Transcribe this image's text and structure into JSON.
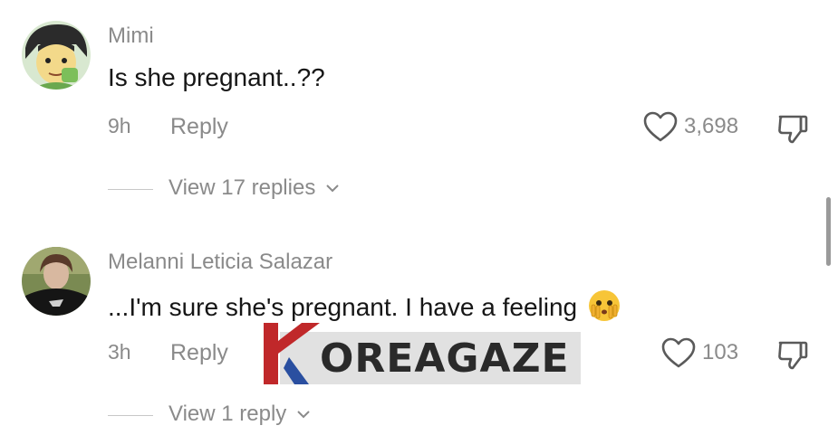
{
  "comments": [
    {
      "username": "Mimi",
      "text": "Is she pregnant..??",
      "time": "9h",
      "reply_label": "Reply",
      "likes": "3,698",
      "view_replies": "View 17 replies"
    },
    {
      "username": "Melanni Leticia Salazar",
      "text": "...I'm sure she's pregnant. I have a feeling",
      "emoji": "face-with-peeking-eye",
      "time": "3h",
      "reply_label": "Reply",
      "likes": "103",
      "view_replies": "View 1 reply"
    }
  ],
  "watermark": {
    "text": "OREAGAZE",
    "brand_red": "#c0282a",
    "brand_blue": "#2a4fa0"
  },
  "icons": {
    "like": "heart-outline-icon",
    "dislike": "thumbs-down-outline-icon",
    "expand": "chevron-down-icon"
  },
  "colors": {
    "text": "#161616",
    "muted": "#8a8a8a"
  }
}
